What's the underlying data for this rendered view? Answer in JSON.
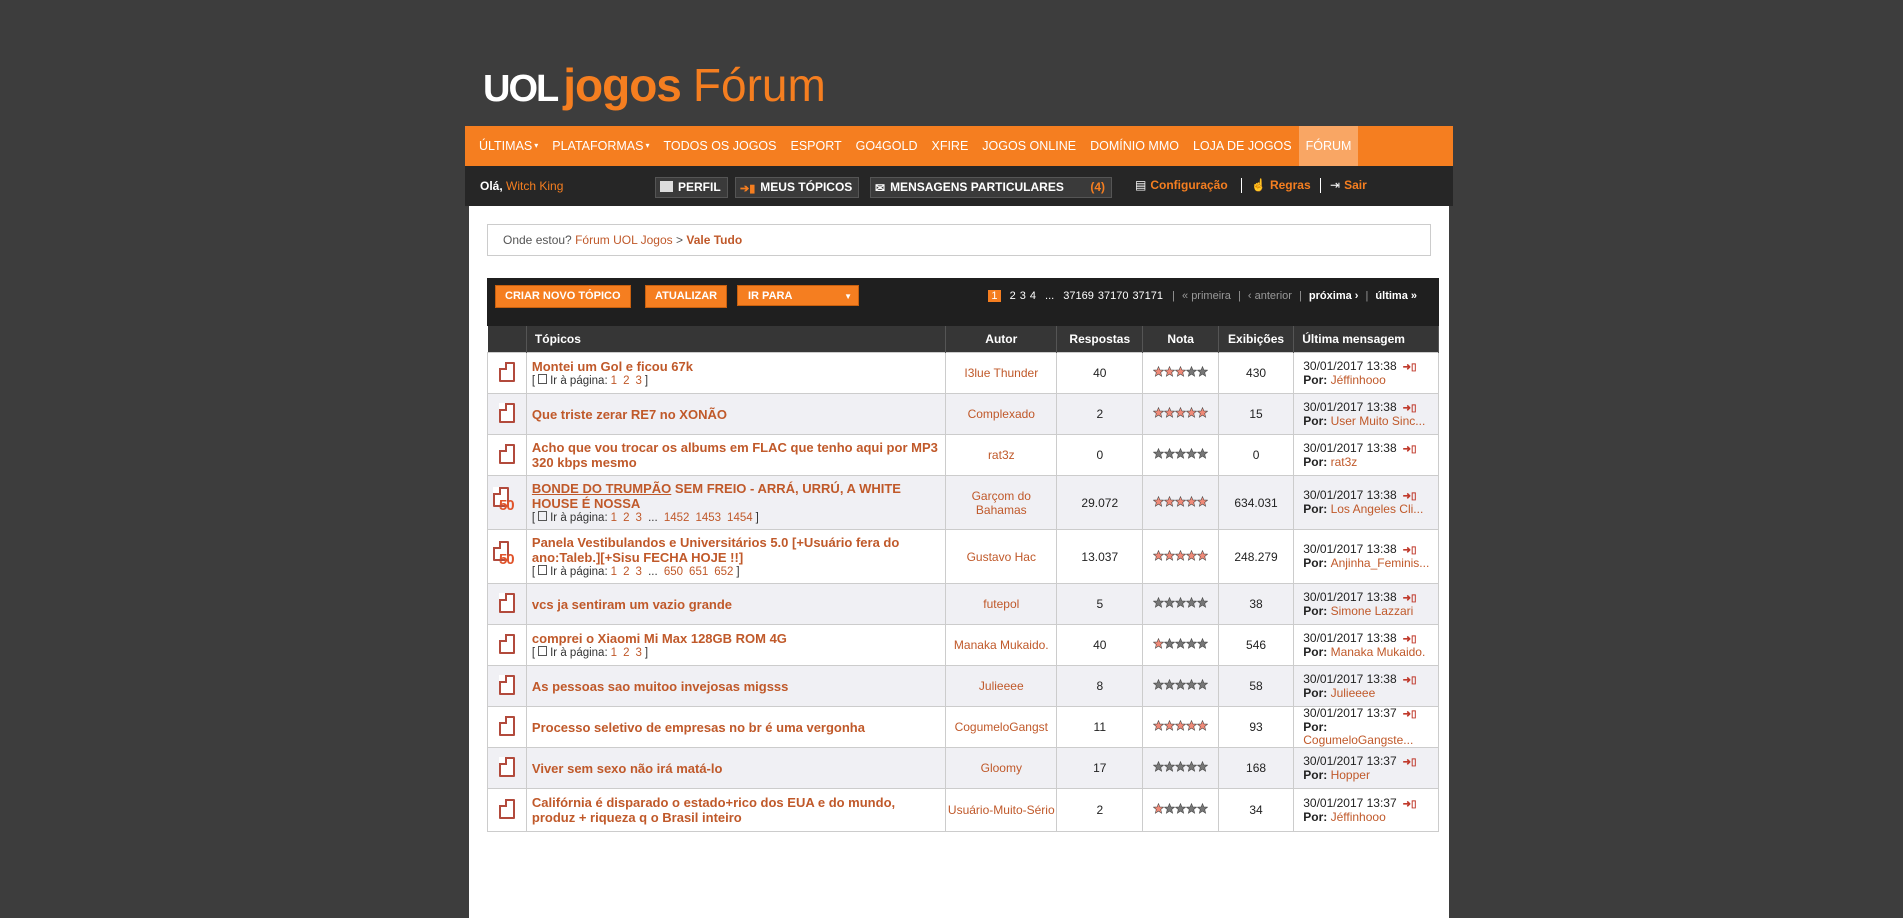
{
  "logo": {
    "uol": "UOL",
    "jogos": "jogos",
    "forum": "Fórum"
  },
  "nav": {
    "items": [
      {
        "label": "ÚLTIMAS",
        "caret": true
      },
      {
        "label": "PLATAFORMAS",
        "caret": true
      },
      {
        "label": "TODOS OS JOGOS"
      },
      {
        "label": "ESPORT"
      },
      {
        "label": "GO4GOLD"
      },
      {
        "label": "XFIRE"
      },
      {
        "label": "JOGOS ONLINE"
      },
      {
        "label": "DOMÍNIO MMO"
      },
      {
        "label": "LOJA DE JOGOS"
      },
      {
        "label": "FÓRUM",
        "active": true
      }
    ]
  },
  "userbar": {
    "hello": "Olá,",
    "username": "Witch King",
    "perfil": "PERFIL",
    "meus_topicos": "MEUS TÓPICOS",
    "mensagens": "MENSAGENS PARTICULARES",
    "mensagens_count": "(4)",
    "configuracao": "Configuração",
    "regras": "Regras",
    "sair": "Sair"
  },
  "breadcrumb": {
    "label": "Onde estou?",
    "root": "Fórum UOL Jogos",
    "sep": ">",
    "current": "Vale Tudo"
  },
  "toolbar": {
    "new_topic": "CRIAR NOVO TÓPICO",
    "refresh": "ATUALIZAR",
    "goto": "IR PARA",
    "pager": {
      "current": "1",
      "pages": [
        "2",
        "3",
        "4"
      ],
      "ellipsis": "...",
      "last_pages": [
        "37169",
        "37170",
        "37171"
      ],
      "first": "« primeira",
      "prev": "‹ anterior",
      "next": "próxima ›",
      "last": "última »"
    }
  },
  "table": {
    "headers": {
      "topics": "Tópicos",
      "author": "Autor",
      "replies": "Respostas",
      "rating": "Nota",
      "views": "Exibições",
      "last": "Última mensagem"
    },
    "page_prefix": "Ir à página:",
    "by_label": "Por:",
    "rows": [
      {
        "hot": false,
        "title": "Montei um Gol e ficou 67k",
        "pages": [
          "1",
          "2",
          "3"
        ],
        "author": "I3lue Thunder",
        "replies": "40",
        "stars": 3,
        "views": "430",
        "date": "30/01/2017 13:38",
        "by": "Jéffinhooo"
      },
      {
        "hot": false,
        "title": "Que triste zerar RE7 no XONÃO",
        "pages": [],
        "author": "Complexado",
        "replies": "2",
        "stars": 5,
        "views": "15",
        "date": "30/01/2017 13:38",
        "by": "User Muito Sinc..."
      },
      {
        "hot": false,
        "title": "Acho que vou trocar os albums em FLAC que tenho aqui por MP3 320 kbps mesmo",
        "pages": [],
        "author": "rat3z",
        "replies": "0",
        "stars": 0,
        "views": "0",
        "date": "30/01/2017 13:38",
        "by": "rat3z"
      },
      {
        "hot": true,
        "title_u": "BONDE DO TRUMPÃO",
        "title": " SEM FREIO - ARRÁ, URRÚ, A WHITE HOUSE É NOSSA",
        "pages": [
          "1",
          "2",
          "3",
          "...",
          "1452",
          "1453",
          "1454"
        ],
        "author": "Garçom do Bahamas",
        "replies": "29.072",
        "stars": 5,
        "views": "634.031",
        "date": "30/01/2017 13:38",
        "by": "Los Angeles Cli..."
      },
      {
        "hot": true,
        "title": "Panela Vestibulandos e Universitários 5.0 [+Usuário fera do ano:Taleb.][+Sisu FECHA HOJE !!]",
        "pages": [
          "1",
          "2",
          "3",
          "...",
          "650",
          "651",
          "652"
        ],
        "author": "Gustavo Hac",
        "replies": "13.037",
        "stars": 5,
        "views": "248.279",
        "date": "30/01/2017 13:38",
        "by": "Anjinha_Feminis..."
      },
      {
        "hot": false,
        "title": "vcs ja sentiram um vazio grande",
        "pages": [],
        "author": "futepol",
        "replies": "5",
        "stars": 0,
        "views": "38",
        "date": "30/01/2017 13:38",
        "by": "Simone Lazzari"
      },
      {
        "hot": false,
        "title": "comprei o Xiaomi Mi Max 128GB ROM 4G",
        "pages": [
          "1",
          "2",
          "3"
        ],
        "author": "Manaka Mukaido.",
        "replies": "40",
        "stars": 1,
        "views": "546",
        "date": "30/01/2017 13:38",
        "by": "Manaka Mukaido."
      },
      {
        "hot": false,
        "title": "As pessoas sao muitoo invejosas migsss",
        "pages": [],
        "author": "Julieeee",
        "replies": "8",
        "stars": 0,
        "views": "58",
        "date": "30/01/2017 13:38",
        "by": "Julieeee"
      },
      {
        "hot": false,
        "title": "Processo seletivo de empresas no br é uma vergonha",
        "pages": [],
        "author": "CogumeloGangst",
        "replies": "11",
        "stars": 5,
        "views": "93",
        "date": "30/01/2017 13:37",
        "by": "CogumeloGangste..."
      },
      {
        "hot": false,
        "title": "Viver sem sexo não irá matá-lo",
        "pages": [],
        "author": "Gloomy",
        "replies": "17",
        "stars": 0,
        "views": "168",
        "date": "30/01/2017 13:37",
        "by": "Hopper"
      },
      {
        "hot": false,
        "title": "Califórnia é disparado o estado+rico dos EUA e do mundo, produz + riqueza q o Brasil inteiro",
        "pages": [],
        "author": "Usuário-Muito-Sério",
        "replies": "2",
        "stars": 1,
        "views": "34",
        "date": "30/01/2017 13:37",
        "by": "Jéffinhooo"
      }
    ]
  },
  "colors": {
    "accent": "#f57e20",
    "link": "#c0592a",
    "background": "#3d3d3d",
    "header_bar": "#262626",
    "table_header": "#363636",
    "star_on": "#f08a78",
    "star_off": "#777777"
  },
  "icons": {
    "perfil": "user-card-icon",
    "meus_topicos": "arrow-doc-icon",
    "mensagens": "envelope-icon",
    "configuracao": "settings-panel-icon",
    "regras": "hand-icon",
    "sair": "exit-door-icon",
    "topic": "document-icon",
    "hot_topic": "hot-document-50-icon",
    "last_post": "go-arrow-icon"
  }
}
